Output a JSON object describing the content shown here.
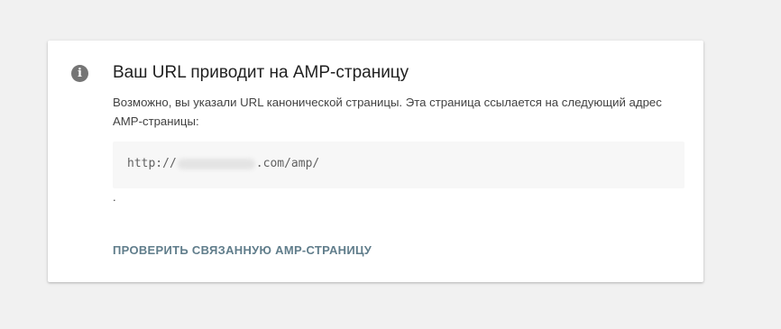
{
  "card": {
    "icon": "info-icon",
    "icon_glyph": "i",
    "title": "Ваш URL приводит на AMP-страницу",
    "description": "Возможно, вы указали URL канонической страницы. Эта страница ссылается на следующий адрес AMP-страницы:",
    "amp_url_prefix": "http://",
    "amp_url_suffix": ".com/amp/",
    "trailing_text": ".",
    "action_label": "ПРОВЕРИТЬ СВЯЗАННУЮ AMP-СТРАНИЦУ"
  },
  "colors": {
    "background": "#f1f1f1",
    "card": "#ffffff",
    "icon": "#757575",
    "action": "#607d8b"
  }
}
